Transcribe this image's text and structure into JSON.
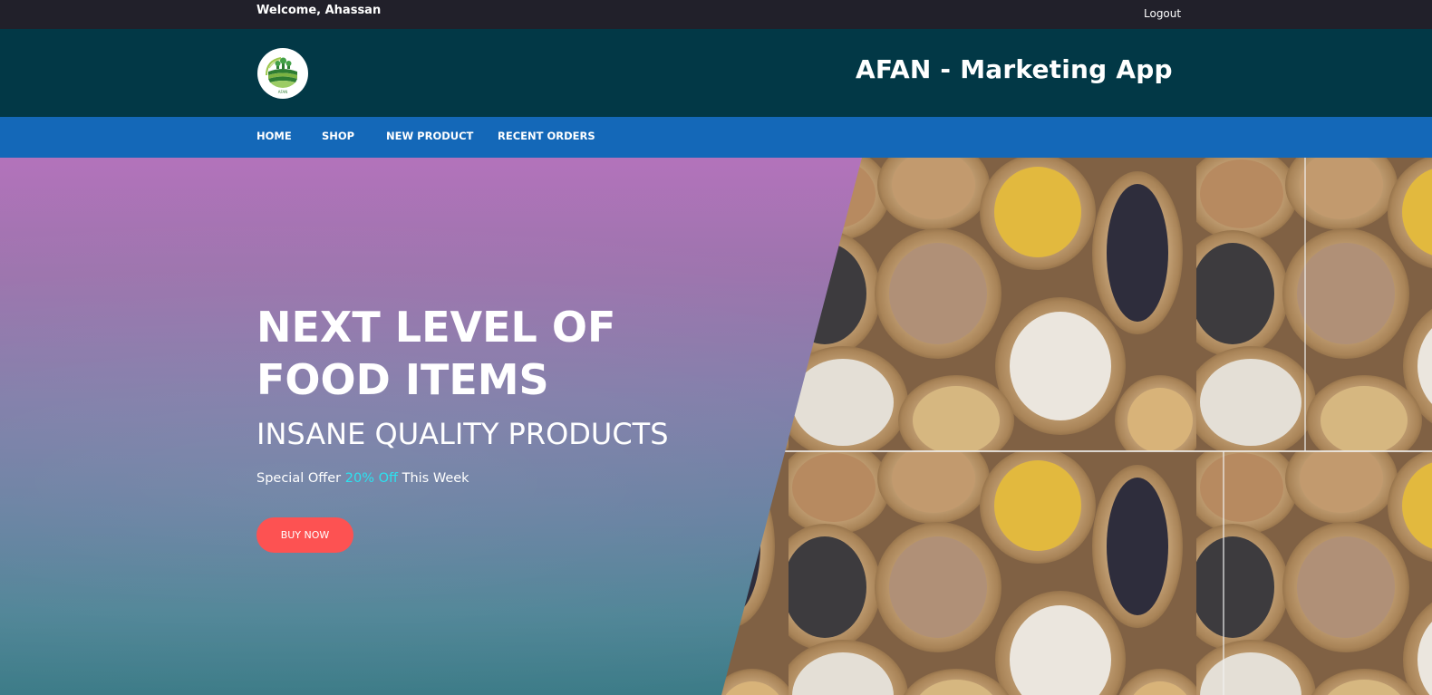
{
  "topbar": {
    "welcome": "Welcome, Ahassan",
    "logout": "Logout"
  },
  "header": {
    "logo_text": "AFAN",
    "title": "AFAN - Marketing App"
  },
  "nav": {
    "items": [
      {
        "label": "HOME"
      },
      {
        "label": "SHOP"
      },
      {
        "label": "NEW PRODUCT"
      },
      {
        "label": "RECENT ORDERS"
      }
    ]
  },
  "hero": {
    "title": "NEXT LEVEL OF FOOD ITEMS",
    "subtitle": "INSANE QUALITY PRODUCTS",
    "offer_prefix": "Special Offer",
    "offer_highlight": "20% Off",
    "offer_suffix": "This Week",
    "button": "BUY NOW"
  },
  "colors": {
    "topbar": "#21202a",
    "brandbar": "#023846",
    "navbar": "#1468b8",
    "accent_button": "#fd5252",
    "offer_highlight": "#2be3f0"
  }
}
